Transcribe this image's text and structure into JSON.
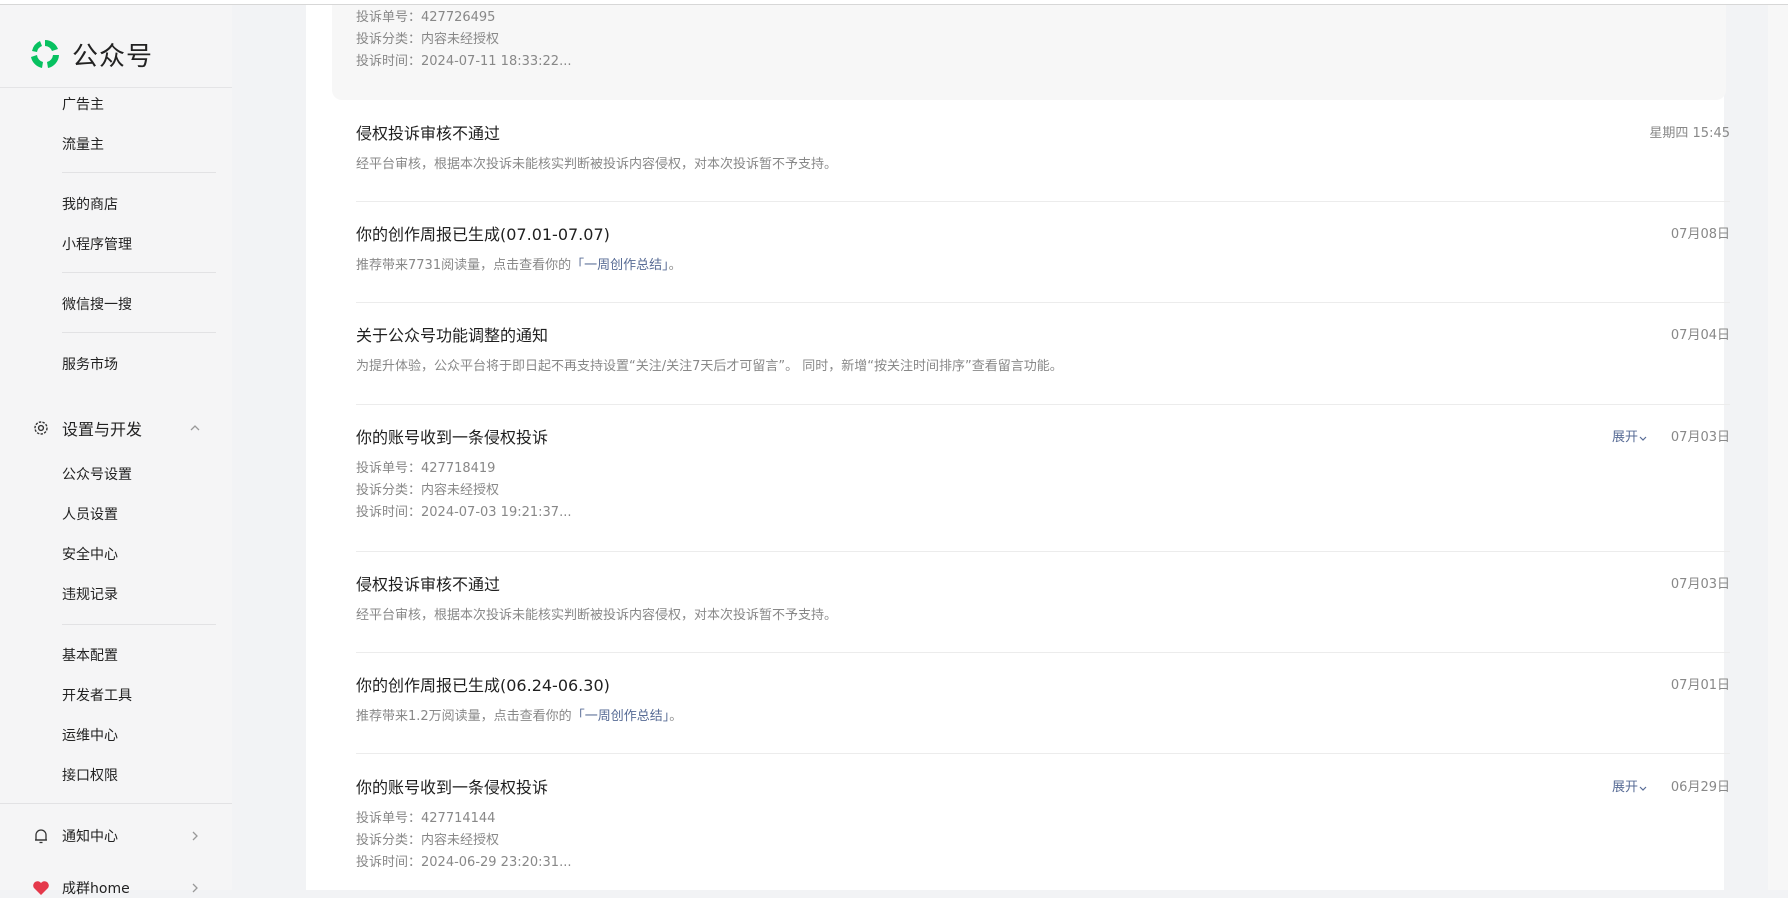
{
  "sidebar": {
    "logo_text": "公众号",
    "group1": [
      "广告主",
      "流量主"
    ],
    "group2": [
      "我的商店",
      "小程序管理"
    ],
    "group3": [
      "微信搜一搜"
    ],
    "group4": [
      "服务市场"
    ],
    "section_dev": "设置与开发",
    "dev_items": [
      "公众号设置",
      "人员设置",
      "安全中心",
      "违规记录"
    ],
    "dev_items2": [
      "基本配置",
      "开发者工具",
      "运维中心",
      "接口权限"
    ],
    "section_notify": "通知中心",
    "section_partial": "成群home"
  },
  "messages": {
    "top": {
      "line1": "投诉单号：427726495",
      "line2": "投诉分类：内容未经授权",
      "line3": "投诉时间：2024-07-11 18:33:22..."
    },
    "items": [
      {
        "title": "侵权投诉审核不通过",
        "desc": "经平台审核，根据本次投诉未能核实判断被投诉内容侵权，对本次投诉暂不予支持。",
        "date": "星期四 15:45"
      },
      {
        "title": "你的创作周报已生成(07.01-07.07)",
        "desc_pre": "推荐带来7731阅读量，点击查看你的",
        "desc_link": "「一周创作总结」",
        "desc_post": "。",
        "date": "07月08日"
      },
      {
        "title": "关于公众号功能调整的通知",
        "desc": "为提升体验，公众平台将于即日起不再支持设置“关注/关注7天后才可留言”。 同时，新增“按关注时间排序”查看留言功能。",
        "date": "07月04日"
      },
      {
        "title": "你的账号收到一条侵权投诉",
        "expand": "展开",
        "line1": "投诉单号：427718419",
        "line2": "投诉分类：内容未经授权",
        "line3": "投诉时间：2024-07-03 19:21:37...",
        "date": "07月03日"
      },
      {
        "title": "侵权投诉审核不通过",
        "desc": "经平台审核，根据本次投诉未能核实判断被投诉内容侵权，对本次投诉暂不予支持。",
        "date": "07月03日"
      },
      {
        "title": "你的创作周报已生成(06.24-06.30)",
        "desc_pre": "推荐带来1.2万阅读量，点击查看你的",
        "desc_link": "「一周创作总结」",
        "desc_post": "。",
        "date": "07月01日"
      },
      {
        "title": "你的账号收到一条侵权投诉",
        "expand": "展开",
        "line1": "投诉单号：427714144",
        "line2": "投诉分类：内容未经授权",
        "line3": "投诉时间：2024-06-29 23:20:31...",
        "date": "06月29日"
      }
    ]
  },
  "colors": {
    "brand_green": "#07c160",
    "link_blue": "#576b95"
  }
}
